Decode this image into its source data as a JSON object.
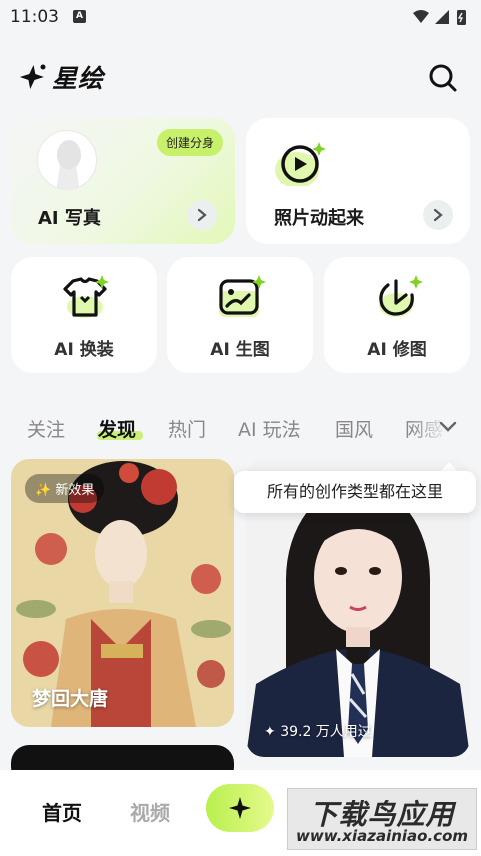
{
  "status": {
    "time": "11:03",
    "a_badge": "A"
  },
  "app": {
    "title": "星绘"
  },
  "features": {
    "portrait": {
      "label": "AI 写真",
      "badge": "创建分身"
    },
    "animate": {
      "label": "照片动起来"
    },
    "swap": {
      "label": "AI 换装"
    },
    "generate": {
      "label": "AI 生图"
    },
    "edit": {
      "label": "AI 修图"
    }
  },
  "tabs": [
    {
      "label": "关注"
    },
    {
      "label": "发现"
    },
    {
      "label": "热门"
    },
    {
      "label": "AI 玩法"
    },
    {
      "label": "国风"
    },
    {
      "label": "网感"
    }
  ],
  "tooltip": "所有的创作类型都在这里",
  "feed": {
    "left": {
      "badge": "新效果",
      "title": "梦回大唐"
    },
    "right": {
      "usage": "39.2 万人用过"
    }
  },
  "bottom_nav": {
    "home": "首页",
    "video": "视频"
  },
  "watermark": {
    "main": "下载鸟应用",
    "sub": "www.xiazainiao.com"
  },
  "colors": {
    "accent": "#c7f06b",
    "background": "#f4f5f7"
  }
}
